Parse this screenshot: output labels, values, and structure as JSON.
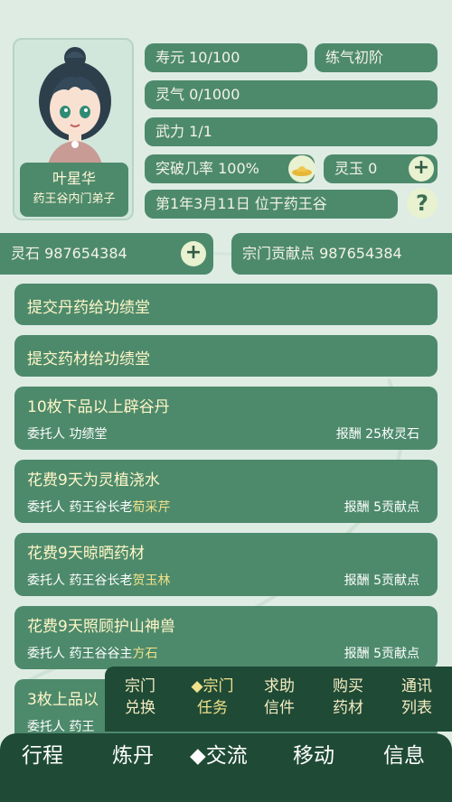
{
  "player": {
    "name": "叶星华",
    "title": "药王谷内门弟子"
  },
  "stats": {
    "lifespan": "寿元 10/100",
    "realm": "练气初阶",
    "spirit": "灵气 0/1000",
    "force": "武力 1/1",
    "breakthrough": "突破几率 100%",
    "jade": "灵玉 0",
    "date_location": "第1年3月11日 位于药王谷"
  },
  "resources": {
    "spirit_stone": "灵石 987654384",
    "contribution": "宗门贡献点 987654384"
  },
  "tasks": [
    {
      "title": "提交丹药给功绩堂"
    },
    {
      "title": "提交药材给功绩堂"
    },
    {
      "title": "10枚下品以上辟谷丹",
      "client_label": "委托人",
      "client": "功绩堂",
      "client_hl": "",
      "reward": "报酬 25枚灵石"
    },
    {
      "title": "花费9天为灵植浇水",
      "client_label": "委托人",
      "client": "药王谷长老",
      "client_hl": "荀采芹",
      "reward": "报酬 5贡献点"
    },
    {
      "title": "花费9天晾晒药材",
      "client_label": "委托人",
      "client": "药王谷长老",
      "client_hl": "贺玉林",
      "reward": "报酬 5贡献点"
    },
    {
      "title": "花费9天照顾护山神兽",
      "client_label": "委托人",
      "client": "药王谷谷主",
      "client_hl": "方石",
      "reward": "报酬 5贡献点"
    },
    {
      "title": "3枚上品以",
      "client_label": "委托人",
      "client": "药王",
      "client_hl": "",
      "reward": ""
    }
  ],
  "submenu": [
    {
      "line1": "宗门",
      "line2": "兑换"
    },
    {
      "line1": "◆宗门",
      "line2": "任务"
    },
    {
      "line1": "求助",
      "line2": "信件"
    },
    {
      "line1": "购买",
      "line2": "药材"
    },
    {
      "line1": "通讯",
      "line2": "列表"
    }
  ],
  "nav": [
    "行程",
    "炼丹",
    "◆交流",
    "移动",
    "信息"
  ],
  "icons": {
    "plus": "+",
    "help": "?",
    "hat": "hat-icon"
  },
  "colors": {
    "panel": "#4d8a6b",
    "nav": "#1f4a36",
    "bg": "#dfece4",
    "highlight": "#f0e28a"
  }
}
